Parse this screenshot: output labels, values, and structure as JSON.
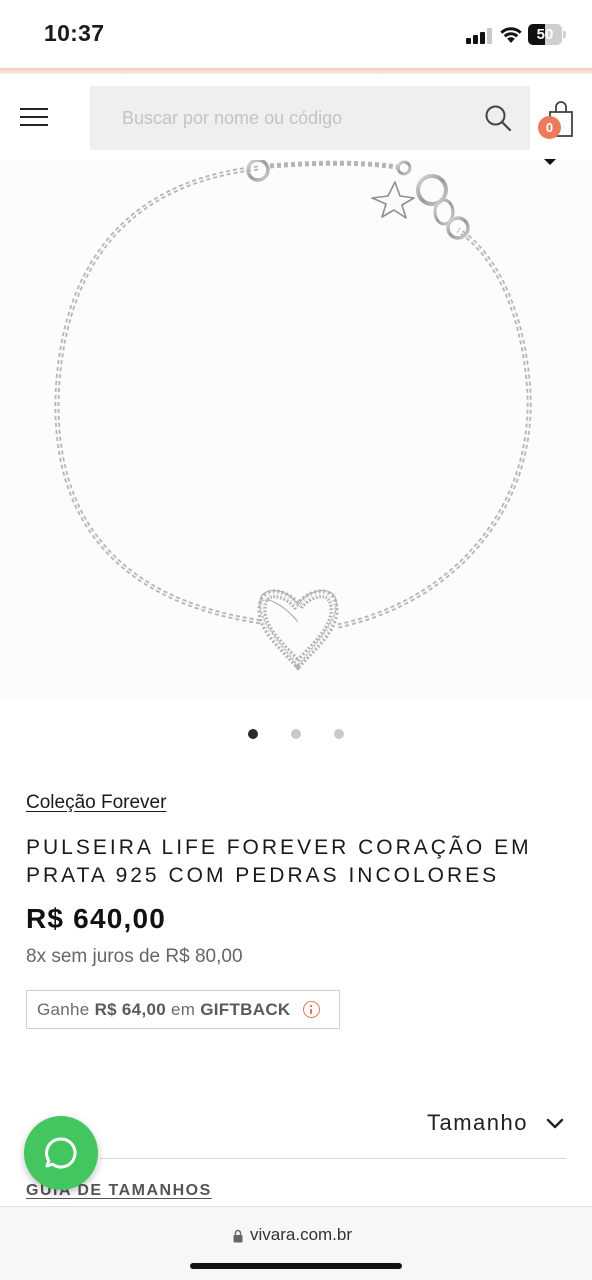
{
  "status_bar": {
    "time": "10:37",
    "battery_level": "50",
    "signal_bars": 3,
    "icons": [
      "cellular-signal-icon",
      "wifi-icon",
      "battery-icon"
    ]
  },
  "header": {
    "search_placeholder": "Buscar por nome ou código",
    "cart_count": "0",
    "icons": [
      "hamburger-menu-icon",
      "search-icon",
      "shopping-bag-icon"
    ]
  },
  "gallery": {
    "image_alt": "Pulseira prata com coração cravejado",
    "slide_count": 3,
    "active_slide": 1
  },
  "product": {
    "collection_link": "Coleção Forever",
    "title": "PULSEIRA LIFE FOREVER CORAÇÃO EM PRATA 925 COM PEDRAS INCOLORES",
    "price": "R$ 640,00",
    "installments": "8x sem juros de R$ 80,00",
    "giftback": {
      "prefix": "Ganhe",
      "amount": "R$ 64,00",
      "middle": "em",
      "label": "GIFTBACK"
    },
    "size_select_label": "Tamanho",
    "size_guide_link": "GUIA DE TAMANHOS"
  },
  "floating": {
    "whatsapp_icon": "whatsapp-chat-icon"
  },
  "browser": {
    "url": "vivara.com.br"
  },
  "colors": {
    "accent": "#ec7b5a",
    "whatsapp": "#43c660",
    "search_bg": "#efefef",
    "accent_line": "#f3cfc3"
  }
}
